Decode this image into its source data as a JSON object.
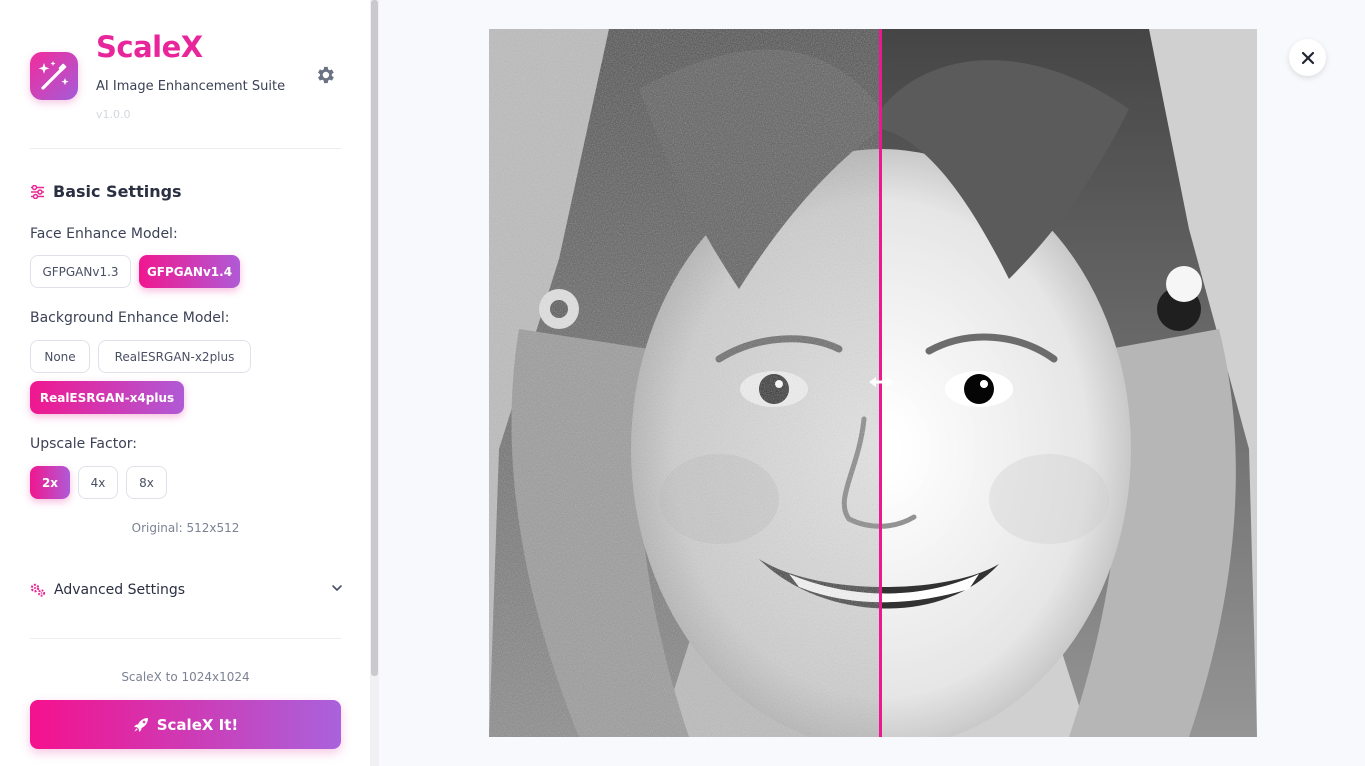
{
  "app": {
    "title": "ScaleX",
    "subtitle": "AI Image Enhancement Suite",
    "version": "v1.0.0",
    "accent": "#e8259a",
    "gradient": [
      "#f0178f",
      "#b05ad6"
    ]
  },
  "icons": {
    "logo": "magic-wand-sparkles-icon",
    "settings": "gear-icon",
    "basic_settings": "sliders-icon",
    "advanced_settings": "cogs-icon",
    "advanced_toggle": "chevron-down-icon",
    "scale_button": "rocket-icon",
    "close": "close-icon",
    "slider_handle": "arrows-left-right-icon"
  },
  "basic_settings": {
    "title": "Basic Settings",
    "face_model": {
      "label": "Face Enhance Model:",
      "options": [
        "GFPGANv1.3",
        "GFPGANv1.4"
      ],
      "selected": "GFPGANv1.4"
    },
    "background_model": {
      "label": "Background Enhance Model:",
      "options": [
        "None",
        "RealESRGAN-x2plus",
        "RealESRGAN-x4plus"
      ],
      "selected": "RealESRGAN-x4plus"
    },
    "upscale": {
      "label": "Upscale Factor:",
      "options": [
        "2x",
        "4x",
        "8x"
      ],
      "selected": "2x"
    },
    "original_note": "Original: 512x512"
  },
  "advanced_settings": {
    "title": "Advanced Settings",
    "expanded": false
  },
  "action": {
    "note": "ScaleX to 1024x1024",
    "button_label": "ScaleX It!"
  },
  "viewer": {
    "split_position": 0.51
  }
}
